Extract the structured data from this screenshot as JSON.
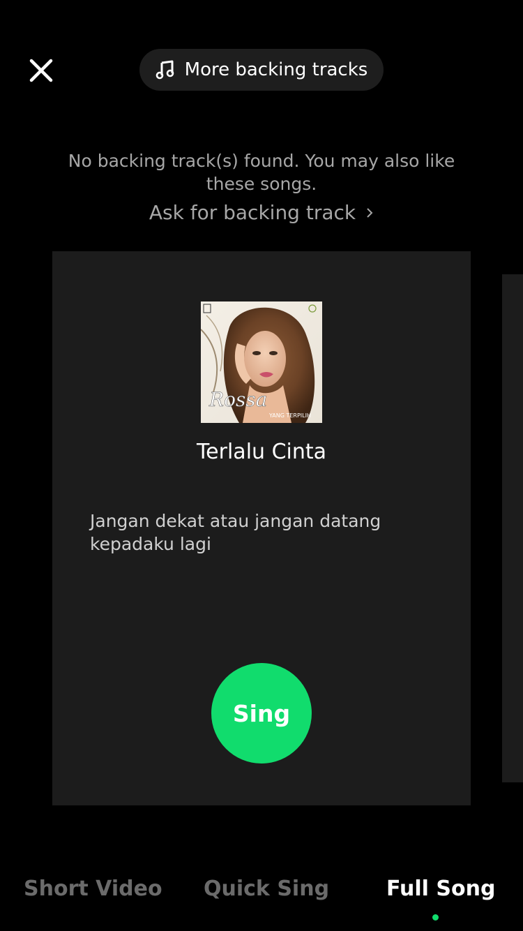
{
  "header": {
    "close_icon": "close-icon",
    "more_tracks": {
      "icon": "music-note-icon",
      "label": "More backing tracks"
    }
  },
  "notice": {
    "message": "No backing track(s) found. You may also like these songs.",
    "ask_link": "Ask for backing track",
    "ask_icon": "chevron-right-icon"
  },
  "card": {
    "cover_signature": "Rossa",
    "cover_subtitle": "YANG TERPILIH",
    "song_title": "Terlalu Cinta",
    "lyrics": "Jangan dekat atau jangan datang kepadaku lagi",
    "sing_label": "Sing"
  },
  "tabs": [
    {
      "label": "Short Video",
      "active": false
    },
    {
      "label": "Quick Sing",
      "active": false
    },
    {
      "label": "Full Song",
      "active": true
    }
  ],
  "colors": {
    "accent": "#11dc6d",
    "background": "#000000",
    "card": "#1c1c1c",
    "inactive_tab": "#6b6b6b",
    "muted_text": "#a7a7a7"
  }
}
